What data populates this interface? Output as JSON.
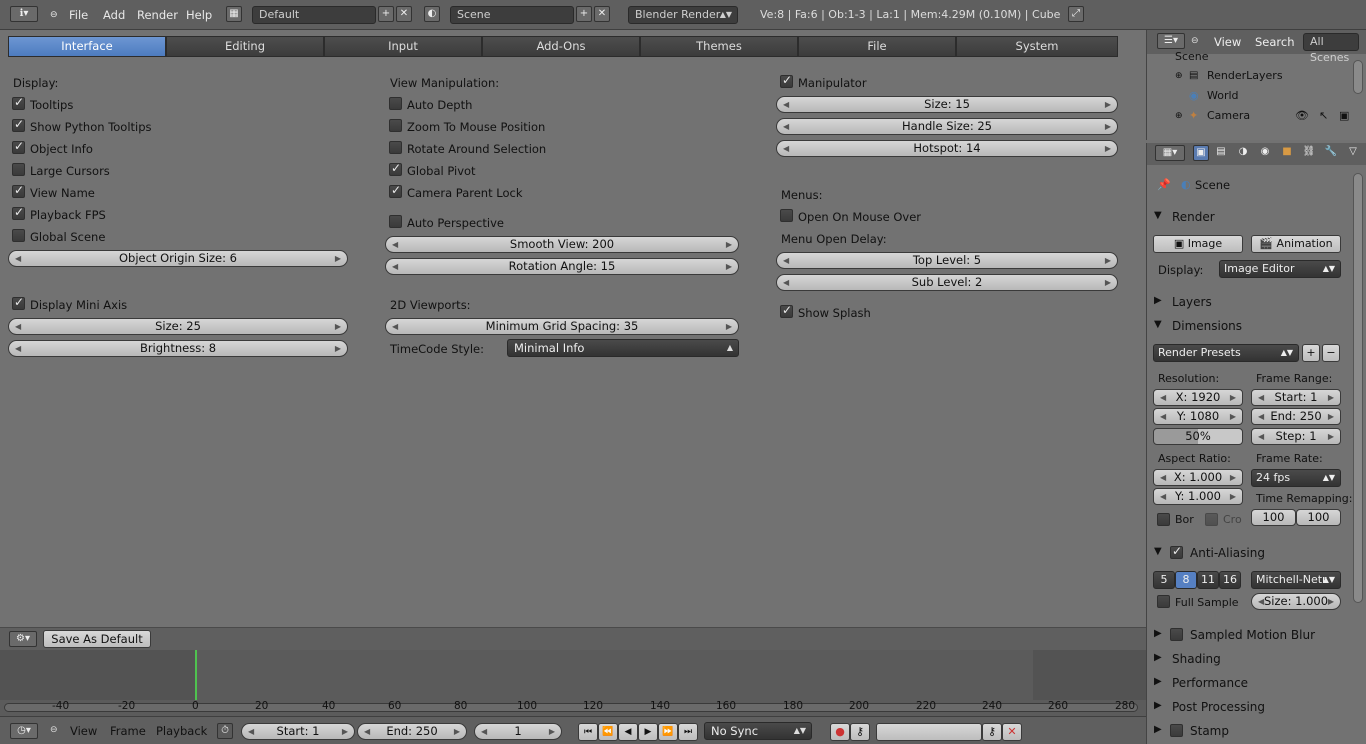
{
  "topbar": {
    "menus": [
      "File",
      "Add",
      "Render",
      "Help"
    ],
    "screen_layout": "Default",
    "scene": "Scene",
    "render_engine": "Blender Render",
    "stats": "Ve:8 | Fa:6 | Ob:1-3 | La:1 | Mem:4.29M (0.10M) | Cube"
  },
  "tabs": [
    "Interface",
    "Editing",
    "Input",
    "Add-Ons",
    "Themes",
    "File",
    "System"
  ],
  "col1": {
    "display_header": "Display:",
    "checks": [
      {
        "label": "Tooltips",
        "checked": true
      },
      {
        "label": "Show Python Tooltips",
        "checked": true
      },
      {
        "label": "Object Info",
        "checked": true
      },
      {
        "label": "Large Cursors",
        "checked": false
      },
      {
        "label": "View Name",
        "checked": true
      },
      {
        "label": "Playback FPS",
        "checked": true
      },
      {
        "label": "Global Scene",
        "checked": false
      }
    ],
    "origin_size": "Object Origin Size: 6",
    "mini_axis": {
      "label": "Display Mini Axis",
      "checked": true
    },
    "size": "Size: 25",
    "brightness": "Brightness: 8"
  },
  "col2": {
    "header": "View Manipulation:",
    "checks": [
      {
        "label": "Auto Depth",
        "checked": false
      },
      {
        "label": "Zoom To Mouse Position",
        "checked": false
      },
      {
        "label": "Rotate Around Selection",
        "checked": false
      },
      {
        "label": "Global Pivot",
        "checked": true
      },
      {
        "label": "Camera Parent Lock",
        "checked": true
      }
    ],
    "auto_perspective": {
      "label": "Auto Perspective",
      "checked": false
    },
    "smooth_view": "Smooth View: 200",
    "rotation_angle": "Rotation Angle: 15",
    "viewports_header": "2D Viewports:",
    "grid_spacing": "Minimum Grid Spacing: 35",
    "timecode_label": "TimeCode Style:",
    "timecode_value": "Minimal Info"
  },
  "col3": {
    "manipulator": {
      "label": "Manipulator",
      "checked": true
    },
    "size": "Size: 15",
    "handle_size": "Handle Size: 25",
    "hotspot": "Hotspot: 14",
    "menus_header": "Menus:",
    "open_on_hover": {
      "label": "Open On Mouse Over",
      "checked": false
    },
    "delay_header": "Menu Open Delay:",
    "top_level": "Top Level: 5",
    "sub_level": "Sub Level: 2",
    "splash": {
      "label": "Show Splash",
      "checked": true
    }
  },
  "footer": {
    "save_default": "Save As Default"
  },
  "outliner": {
    "menus": [
      "View",
      "Search"
    ],
    "filter": "All Scenes",
    "items": [
      "Scene",
      "RenderLayers",
      "World",
      "Camera"
    ]
  },
  "props": {
    "scene": "Scene",
    "render_header": "Render",
    "image_btn": "Image",
    "animation_btn": "Animation",
    "display_label": "Display:",
    "display_value": "Image Editor",
    "layers": "Layers",
    "dimensions": "Dimensions",
    "render_presets": "Render Presets",
    "resolution_label": "Resolution:",
    "res_x": "X: 1920",
    "res_y": "Y: 1080",
    "res_pct": "50%",
    "frame_range_label": "Frame Range:",
    "start": "Start: 1",
    "end": "End: 250",
    "step": "Step: 1",
    "aspect_label": "Aspect Ratio:",
    "asp_x": "X: 1.000",
    "asp_y": "Y: 1.000",
    "frame_rate_label": "Frame Rate:",
    "fps": "24 fps",
    "time_remap_label": "Time Remapping:",
    "remap_old": "100",
    "remap_new": "100",
    "bor": "Bor",
    "cro": "Cro",
    "anti_aliasing": "Anti-Aliasing",
    "aa_samples": [
      "5",
      "8",
      "11",
      "16"
    ],
    "aa_filter": "Mitchell-Netr",
    "full_sample": "Full Sample",
    "aa_size": "Size: 1.000",
    "sampled_motion_blur": "Sampled Motion Blur",
    "shading": "Shading",
    "performance": "Performance",
    "post_processing": "Post Processing",
    "stamp": "Stamp"
  },
  "timeline": {
    "ticks": [
      "-40",
      "-20",
      "0",
      "20",
      "40",
      "60",
      "80",
      "100",
      "120",
      "140",
      "160",
      "180",
      "200",
      "220",
      "240",
      "260",
      "280"
    ],
    "menus": [
      "View",
      "Frame",
      "Playback"
    ],
    "start": "Start: 1",
    "end": "End: 250",
    "current": "1",
    "sync": "No Sync"
  }
}
